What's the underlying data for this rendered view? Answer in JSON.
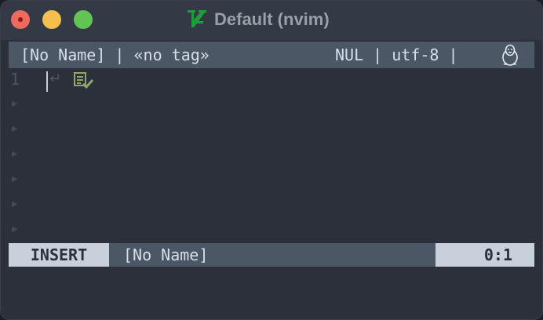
{
  "window": {
    "title": "Default (nvim)",
    "logo_icon": "vim-logo-icon"
  },
  "tabline": {
    "left_text": "[No Name] | «no tag»",
    "right_text": "NUL | utf-8 |",
    "os_icon": "tux-linux-icon"
  },
  "editor": {
    "line_number": "1",
    "return_glyph": "↵",
    "file_icon": "document-check-icon",
    "empty_line_marker": "▶"
  },
  "statusline": {
    "mode": "INSERT",
    "file": "[No Name]",
    "position": "0:1"
  },
  "colors": {
    "background": "#2b303b",
    "bar": "#4c5766",
    "mode_bg": "#c8d0dc",
    "vim_green": "#1f9d3a",
    "icon_green": "#8fa66b"
  }
}
